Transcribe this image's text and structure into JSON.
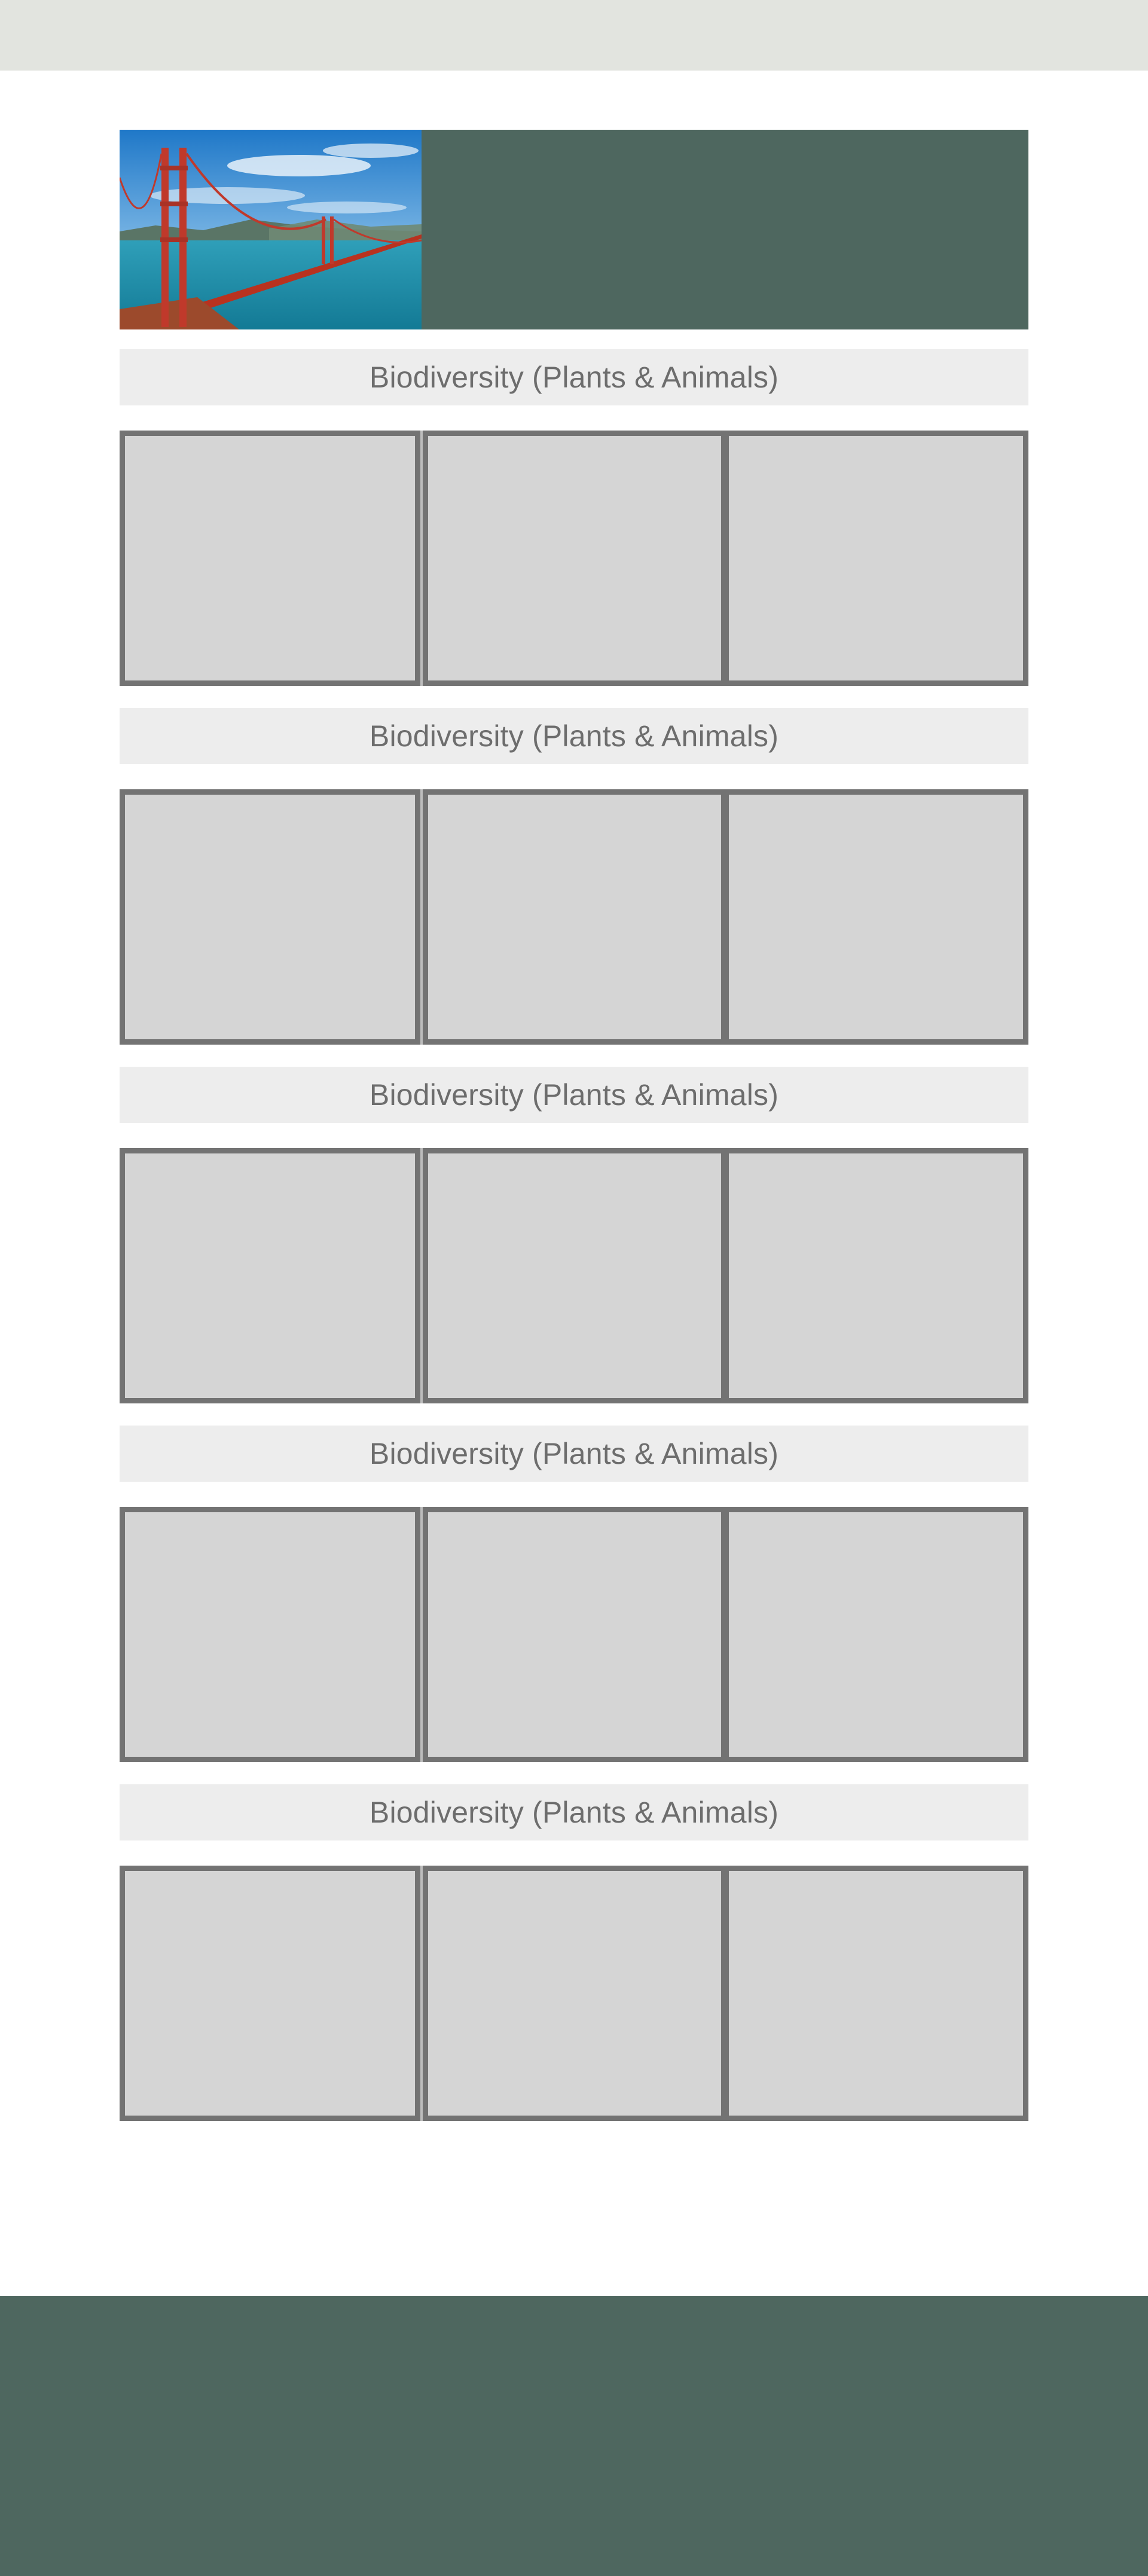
{
  "colors": {
    "top_bar": "#e2e4df",
    "brand_green": "#4e675f",
    "section_header_bg": "#ededed",
    "section_header_text": "#6d6d6d",
    "card_fill": "#d5d5d5",
    "card_border": "#737373"
  },
  "hero": {
    "image": "golden-gate-bridge-photo"
  },
  "sections": [
    {
      "title": "Biodiversity (Plants & Animals)"
    },
    {
      "title": "Biodiversity (Plants & Animals)"
    },
    {
      "title": "Biodiversity (Plants & Animals)"
    },
    {
      "title": "Biodiversity (Plants & Animals)"
    },
    {
      "title": "Biodiversity (Plants & Animals)"
    }
  ]
}
